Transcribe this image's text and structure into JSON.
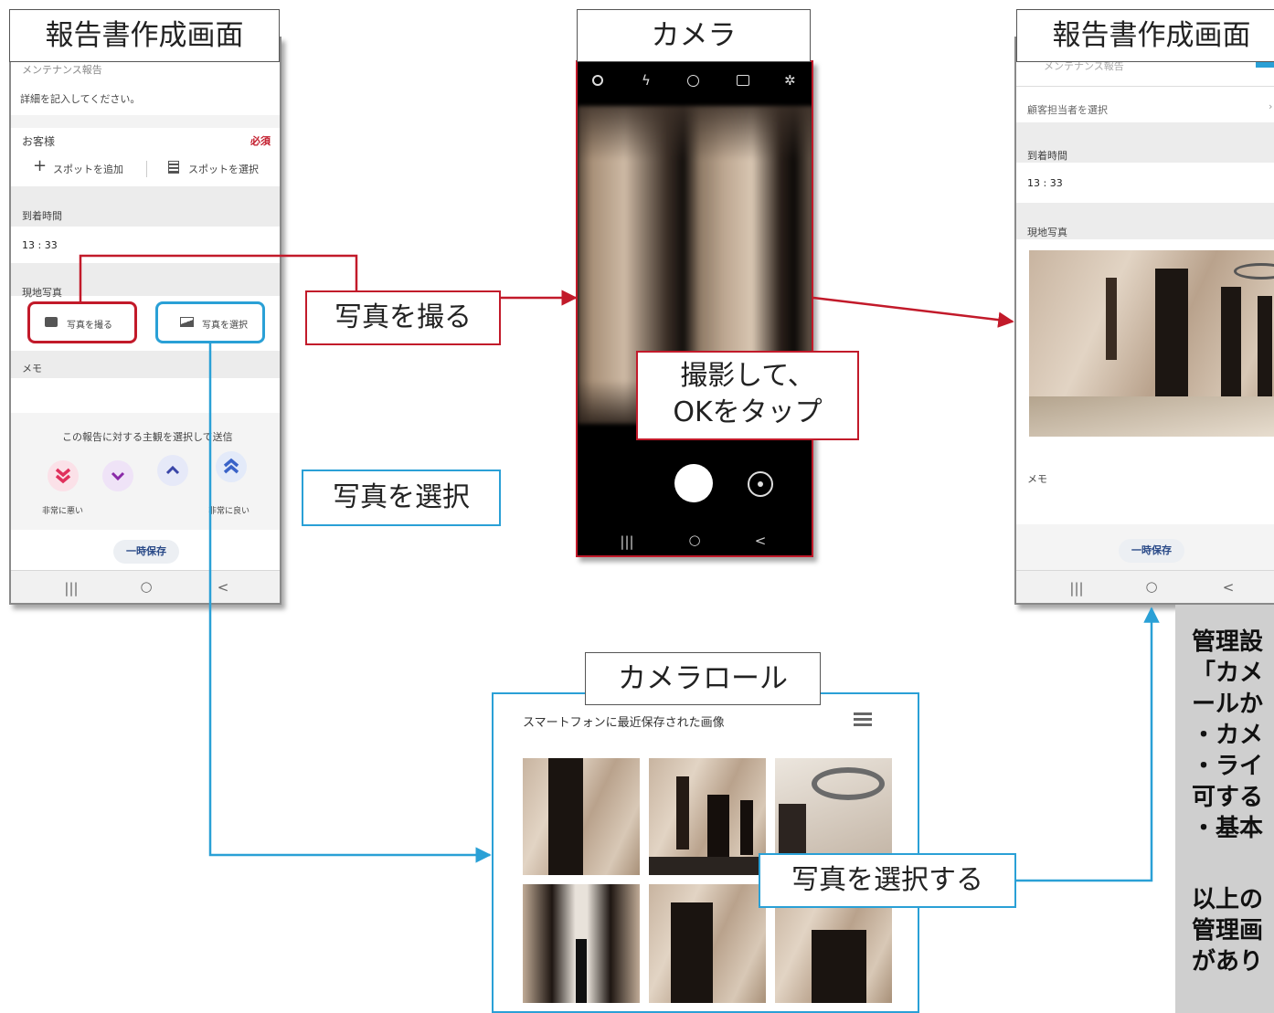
{
  "colors": {
    "red": "#c21a2a",
    "blue": "#2aa0d6",
    "note_bg": "#cfcfcf"
  },
  "screen1": {
    "title": "報告書作成画面",
    "top_text": "メンテナンス報告",
    "instruction": "詳細を記入してください。",
    "customer_label": "お客様",
    "required": "必須",
    "add_spot": "スポットを追加",
    "select_spot": "スポットを選択",
    "arrival_label": "到着時間",
    "arrival_time": "13 : 33",
    "photo_label": "現地写真",
    "take_photo": "写真を撮る",
    "select_photo": "写真を選択",
    "memo_label": "メモ",
    "feedback_prompt": "この報告に対する主観を選択して送信",
    "very_bad": "非常に悪い",
    "very_good": "非常に良い",
    "temp_save": "一時保存",
    "icons": [
      "add-icon",
      "building-icon",
      "camera-icon",
      "image-icon",
      "double-chevron-down-icon",
      "chevron-down-icon",
      "chevron-up-icon",
      "double-chevron-up-icon"
    ]
  },
  "camera": {
    "title": "カメラ",
    "icons": [
      "settings-icon",
      "flash-off-icon",
      "timer-off-icon",
      "ratio-icon",
      "sparkle-icon",
      "shutter-button",
      "flip-camera-icon"
    ]
  },
  "screen2": {
    "title": "報告書作成画面",
    "top_text": "メンテナンス報告",
    "customer_contact": "顧客担当者を選択",
    "arrival_label": "到着時間",
    "arrival_time": "13 : 33",
    "photo_label": "現地写真",
    "memo_label": "メモ",
    "temp_save": "一時保存"
  },
  "camera_roll": {
    "title": "カメラロール",
    "header": "スマートフォンに最近保存された画像",
    "icons": [
      "list-icon"
    ]
  },
  "nav": {
    "recent": "|||",
    "home": "○",
    "back": "<"
  },
  "callouts": {
    "take_photo": "写真を撮る",
    "shoot_line1": "撮影して、",
    "shoot_line2": "OKをタップ",
    "select_photo": "写真を選択",
    "select_photo_do": "写真を選択する"
  },
  "note": {
    "lines": [
      "管理設",
      "「カメ",
      "ールか",
      "・カメ",
      "・ライ",
      "可する",
      "・基本",
      "",
      "以上の",
      "管理画",
      "があり"
    ]
  }
}
